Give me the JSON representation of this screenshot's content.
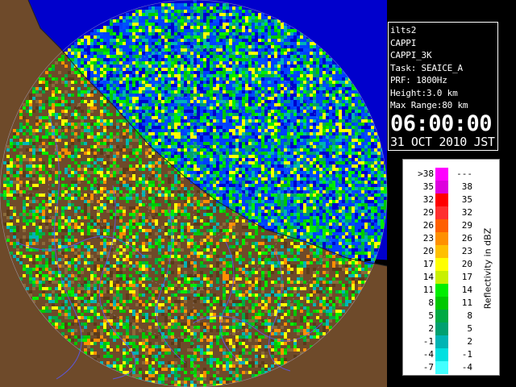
{
  "info": {
    "station": "ilts2",
    "product": "CAPPI",
    "product_name": "CAPPI_3K",
    "task": "Task: SEAICE_A",
    "prf": "PRF: 1800Hz",
    "height": "Height:3.0 km",
    "max_range": "Max Range:80 km",
    "time": "06:00:00",
    "date": "31 OCT 2010 JST"
  },
  "legend": {
    "title": "Reflectivity in dBZ",
    "rows": [
      {
        "low": ">38",
        "high": "---",
        "color": "#ff00ff"
      },
      {
        "low": "35",
        "high": "38",
        "color": "#dd00dd"
      },
      {
        "low": "32",
        "high": "35",
        "color": "#ff0000"
      },
      {
        "low": "29",
        "high": "32",
        "color": "#ff3030"
      },
      {
        "low": "26",
        "high": "29",
        "color": "#ff6000"
      },
      {
        "low": "23",
        "high": "26",
        "color": "#ff9000"
      },
      {
        "low": "20",
        "high": "23",
        "color": "#ffc000"
      },
      {
        "low": "17",
        "high": "20",
        "color": "#ffff00"
      },
      {
        "low": "14",
        "high": "17",
        "color": "#c8f000"
      },
      {
        "low": "11",
        "high": "14",
        "color": "#00ee00"
      },
      {
        "low": "8",
        "high": "11",
        "color": "#00c800"
      },
      {
        "low": "5",
        "high": "8",
        "color": "#00aa44"
      },
      {
        "low": "2",
        "high": "5",
        "color": "#00a070"
      },
      {
        "low": "-1",
        "high": "2",
        "color": "#00b4b4"
      },
      {
        "low": "-4",
        "high": "-1",
        "color": "#00e0e0"
      },
      {
        "low": "-7",
        "high": "-4",
        "color": "#44ffff"
      }
    ]
  },
  "map_colors": {
    "sea": "#0000cc",
    "sea_echo": "#0040ff",
    "land": "#6e4a2a",
    "range_ring": "#aaaacc",
    "river": "#5a5aff"
  }
}
